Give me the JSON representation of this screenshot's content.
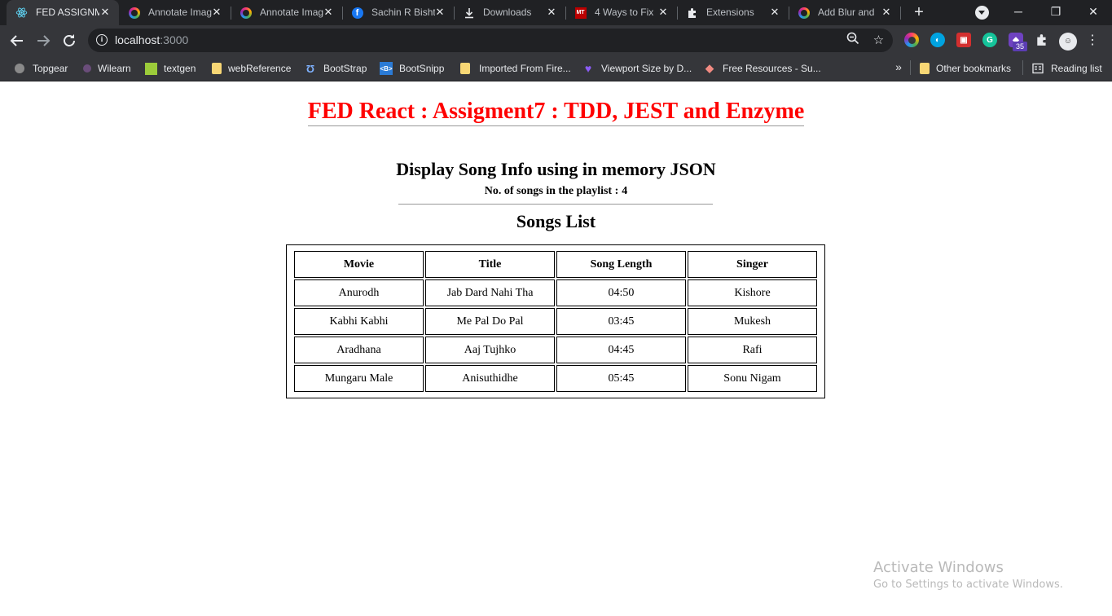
{
  "tabs": [
    {
      "title": "FED ASSIGNMENT",
      "icon": "react-icon",
      "active": true
    },
    {
      "title": "Annotate Images",
      "icon": "annotate-icon"
    },
    {
      "title": "Annotate Images",
      "icon": "annotate-icon"
    },
    {
      "title": "Sachin R Bisht",
      "icon": "facebook-icon"
    },
    {
      "title": "Downloads",
      "icon": "download-icon"
    },
    {
      "title": "4 Ways to Fix",
      "icon": "mt-icon"
    },
    {
      "title": "Extensions",
      "icon": "puzzle-icon"
    },
    {
      "title": "Add Blur and",
      "icon": "annotate-icon"
    }
  ],
  "address": {
    "host": "localhost",
    "port": ":3000"
  },
  "bookmarks": [
    {
      "label": "Topgear"
    },
    {
      "label": "Wilearn"
    },
    {
      "label": "textgen"
    },
    {
      "label": "webReference"
    },
    {
      "label": "BootStrap"
    },
    {
      "label": "BootSnipp"
    },
    {
      "label": "Imported From Fire..."
    },
    {
      "label": "Viewport Size by D..."
    },
    {
      "label": "Free Resources - Su..."
    }
  ],
  "bookmarks_other": "Other bookmarks",
  "reading_list": "Reading list",
  "extension_badge": "35",
  "overflow_label": "»",
  "page": {
    "title": "FED React : Assigment7 : TDD, JEST and Enzyme",
    "heading": "Display Song Info using in memory JSON",
    "count_label": "No. of songs in the playlist :",
    "count_value": "4",
    "list_title": "Songs List",
    "columns": [
      "Movie",
      "Title",
      "Song Length",
      "Singer"
    ],
    "rows": [
      [
        "Anurodh",
        "Jab Dard Nahi Tha",
        "04:50",
        "Kishore"
      ],
      [
        "Kabhi Kabhi",
        "Me Pal Do Pal",
        "03:45",
        "Mukesh"
      ],
      [
        "Aradhana",
        "Aaj Tujhko",
        "04:45",
        "Rafi"
      ],
      [
        "Mungaru Male",
        "Anisuthidhe",
        "05:45",
        "Sonu Nigam"
      ]
    ]
  },
  "watermark": {
    "line1": "Activate Windows",
    "line2": "Go to Settings to activate Windows."
  },
  "colors": {
    "title_red": "#ff0000",
    "chrome_dark": "#202124",
    "chrome_toolbar": "#35363a"
  }
}
